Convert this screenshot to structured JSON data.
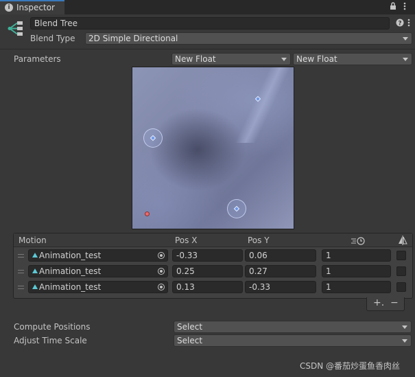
{
  "tab": {
    "title": "Inspector"
  },
  "header": {
    "name_value": "Blend Tree",
    "blend_type_label": "Blend Type",
    "blend_type_value": "2D Simple Directional"
  },
  "parameters": {
    "label": "Parameters",
    "param_x": "New Float",
    "param_y": "New Float"
  },
  "motion_list": {
    "headers": {
      "motion": "Motion",
      "pos_x": "Pos X",
      "pos_y": "Pos Y"
    },
    "rows": [
      {
        "motion": "Animation_test",
        "pos_x": "-0.33",
        "pos_y": "0.06",
        "speed": "1",
        "mirror": false
      },
      {
        "motion": "Animation_test",
        "pos_x": "0.25",
        "pos_y": "0.27",
        "speed": "1",
        "mirror": false
      },
      {
        "motion": "Animation_test",
        "pos_x": "0.13",
        "pos_y": "-0.33",
        "speed": "1",
        "mirror": false
      }
    ],
    "add_label": "+.",
    "remove_label": "−"
  },
  "footer": {
    "compute_positions_label": "Compute Positions",
    "compute_positions_value": "Select",
    "adjust_time_scale_label": "Adjust Time Scale",
    "adjust_time_scale_value": "Select"
  },
  "watermark": "CSDN @番茄炒蛋鱼香肉丝",
  "colors": {
    "background": "#383838",
    "field": "#2a2a2a",
    "tab_accent": "#3a79bb",
    "current_point": "#ee6a6a",
    "motion_point": "#6f97e8"
  }
}
